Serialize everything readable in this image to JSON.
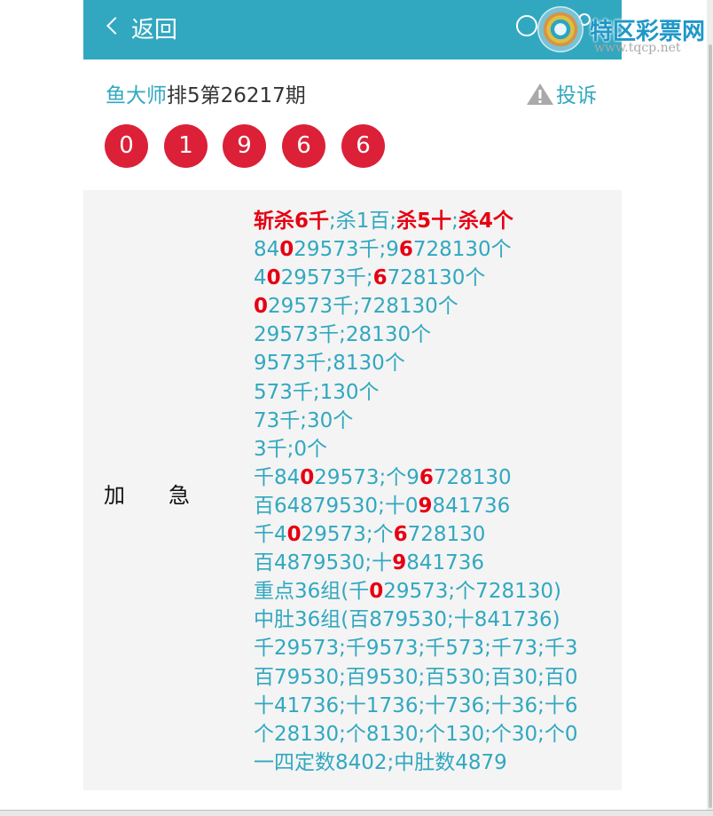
{
  "header": {
    "back_label": "返回",
    "search_icon": "search-icon",
    "user_icon": "user-icon"
  },
  "watermark": {
    "title": "特区彩票网",
    "url": "www.tqcp.net"
  },
  "article": {
    "author": "鱼大师",
    "issue": "排5第26217期",
    "report_label": "投诉",
    "report_icon": "warning-icon",
    "balls": [
      "0",
      "1",
      "9",
      "6",
      "6"
    ]
  },
  "detail": {
    "label_left": "加",
    "label_right": "急",
    "lines": [
      [
        {
          "t": "斩杀6千",
          "h": true
        },
        {
          "t": ";杀1百;"
        },
        {
          "t": "杀5十",
          "h": true
        },
        {
          "t": ";"
        },
        {
          "t": "杀4个",
          "h": true
        }
      ],
      [
        {
          "t": "84"
        },
        {
          "t": "0",
          "h": true
        },
        {
          "t": "29573千;9"
        },
        {
          "t": "6",
          "h": true
        },
        {
          "t": "728130个"
        }
      ],
      [
        {
          "t": "4"
        },
        {
          "t": "0",
          "h": true
        },
        {
          "t": "29573千;"
        },
        {
          "t": "6",
          "h": true
        },
        {
          "t": "728130个"
        }
      ],
      [
        {
          "t": "0",
          "h": true
        },
        {
          "t": "29573千;728130个"
        }
      ],
      [
        {
          "t": "29573千;28130个"
        }
      ],
      [
        {
          "t": "9573千;8130个"
        }
      ],
      [
        {
          "t": "573千;130个"
        }
      ],
      [
        {
          "t": "73千;30个"
        }
      ],
      [
        {
          "t": "3千;0个"
        }
      ],
      [
        {
          "t": "千84"
        },
        {
          "t": "0",
          "h": true
        },
        {
          "t": "29573;个9"
        },
        {
          "t": "6",
          "h": true
        },
        {
          "t": "728130"
        }
      ],
      [
        {
          "t": "百64879530;十0"
        },
        {
          "t": "9",
          "h": true
        },
        {
          "t": "841736"
        }
      ],
      [
        {
          "t": "千4"
        },
        {
          "t": "0",
          "h": true
        },
        {
          "t": "29573;个"
        },
        {
          "t": "6",
          "h": true
        },
        {
          "t": "728130"
        }
      ],
      [
        {
          "t": "百4879530;十"
        },
        {
          "t": "9",
          "h": true
        },
        {
          "t": "841736"
        }
      ],
      [
        {
          "t": "重点36组(千"
        },
        {
          "t": "0",
          "h": true
        },
        {
          "t": "29573;个728130)"
        }
      ],
      [
        {
          "t": "中肚36组(百879530;十841736)"
        }
      ],
      [
        {
          "t": "千29573;千9573;千573;千73;千3"
        }
      ],
      [
        {
          "t": "百79530;百9530;百530;百30;百0"
        }
      ],
      [
        {
          "t": "十41736;十1736;十736;十36;十6"
        }
      ],
      [
        {
          "t": "个28130;个8130;个130;个30;个0"
        }
      ],
      [
        {
          "t": "一四定数8402;中肚数4879"
        }
      ]
    ]
  },
  "colors": {
    "header_bg": "#31a8c0",
    "accent_text": "#31a8c0",
    "highlight": "#e60012",
    "ball": "#dc2038",
    "panel_bg": "#f4f4f4"
  }
}
